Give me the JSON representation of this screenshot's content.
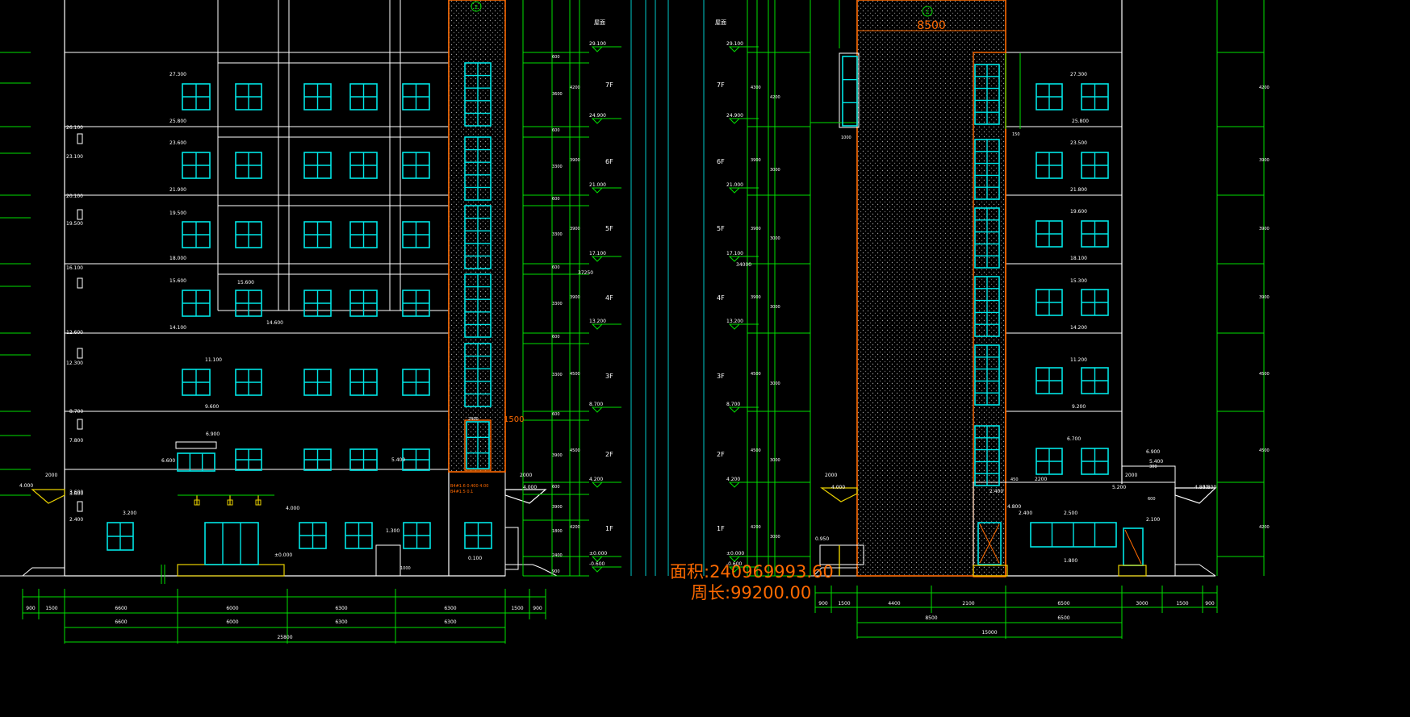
{
  "viewport": {
    "width": 1747,
    "height": 889
  },
  "colors": {
    "background": "#000000",
    "wall": "#ffffff",
    "window": "#00e5e5",
    "dim": "#00e000",
    "accent": "#ff6a00",
    "yellow": "#e8d000",
    "hatch": "#7f7f7f",
    "label_white": "#ffffff"
  },
  "left_elevation": {
    "axis_label": "2",
    "roof_label": "屋面",
    "floors": [
      "7F",
      "6F",
      "5F",
      "4F",
      "3F",
      "2F",
      "1F"
    ],
    "levels_right": [
      "29.100",
      "24.900",
      "21.000",
      "17.100",
      "13.200",
      "8.700",
      "4.200",
      "±0.000",
      "-0.600"
    ],
    "window_levels": [
      "27.300",
      "25.800",
      "23.600",
      "21.900",
      "19.500",
      "18.000",
      "15.600",
      "14.100",
      "11.100",
      "9.600",
      "6.900",
      "6.600",
      "5.400",
      "3.600",
      "3.200",
      "2.400",
      "±0.000",
      "0.100"
    ],
    "left_levels": [
      "26.100",
      "23.100",
      "20.100",
      "19.500",
      "16.100",
      "12.600",
      "12.300",
      "8.700",
      "7.800",
      "4.000",
      "3.600"
    ],
    "label_4000": "4.000",
    "label_2000": "2000",
    "annotation_ew": "4.000",
    "annotation_ew2": "4.000",
    "annotation_1000": "1000",
    "annotation_mid": "14.600",
    "dim_total": "37250",
    "dims_bottom_row1": [
      "900",
      "1500",
      "6600",
      "6000",
      "6300",
      "6300",
      "1500",
      "900"
    ],
    "dims_bottom_row2": [
      "6600",
      "6000",
      "6300",
      "6300"
    ],
    "dims_bottom_total": "25800",
    "dims_right_col1": [
      "600",
      "3600",
      "600",
      "3300",
      "600",
      "3300",
      "600",
      "3300",
      "600",
      "3300",
      "600",
      "3900",
      "600",
      "3900",
      "1800",
      "2400",
      "900"
    ],
    "dims_right_col2": [
      "4200",
      "3900",
      "3900",
      "3900",
      "4500",
      "4500",
      "4200"
    ],
    "stair_label": "1500",
    "stair_label2": "2400",
    "stair_note": "B4#1.6 0.400 4.00",
    "stair_note2": "B4#1.5 0.1"
  },
  "overlay": {
    "area_text": "面积:240969993.60",
    "perimeter_text": "周长:99200.00"
  },
  "right_elevation": {
    "axis_label": "2",
    "width_label": "8500",
    "roof_label": "屋面",
    "floors": [
      "7F",
      "6F",
      "5F",
      "4F",
      "3F",
      "2F",
      "1F"
    ],
    "levels_left": [
      "29.100",
      "24.900",
      "21.000",
      "17.100",
      "13.200",
      "8.700",
      "4.200",
      "±0.000",
      "-0.600"
    ],
    "window_levels": [
      "27.300",
      "25.800",
      "23.500",
      "21.800",
      "19.600",
      "18.100",
      "15.300",
      "14.200",
      "11.200",
      "9.200",
      "6.700",
      "5.400",
      "5.200",
      "4.800",
      "2.400",
      "2.500",
      "2.100",
      "1.800",
      "6.900",
      "0.950"
    ],
    "left_dims": [
      "4300",
      "3900",
      "3900",
      "3900",
      "4500",
      "4500",
      "4200"
    ],
    "left_dims2": [
      "4200",
      "3000",
      "3000",
      "3000",
      "3000",
      "3000",
      "3000"
    ],
    "right_dims": [
      "4200",
      "3900",
      "3900",
      "3900",
      "4500",
      "4500",
      "4200"
    ],
    "dim_total": "34000",
    "dims_bottom_row1": [
      "900",
      "1500",
      "4400",
      "2100",
      "6500",
      "3000",
      "1500",
      "900"
    ],
    "dims_bottom_row2": [
      "8500",
      "6500"
    ],
    "dims_bottom_total": "15000",
    "label_1000": "1000",
    "label_150": "150",
    "label_3000": "3000",
    "label_2000": "2000",
    "label_4000": "4.000",
    "label_450": "450",
    "label_2200": "2200",
    "label_4800": "4.800",
    "label_600": "600",
    "label_300": "300",
    "label_3900": "3900"
  }
}
